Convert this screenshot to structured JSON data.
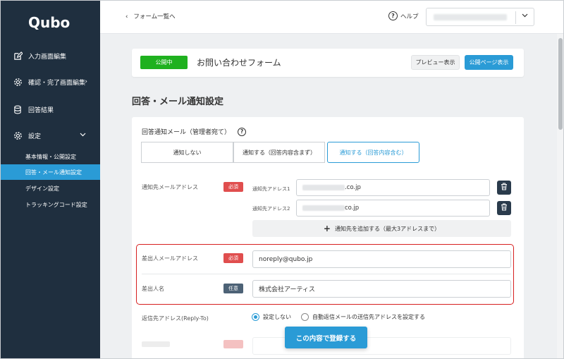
{
  "app": {
    "logo": "Qubo"
  },
  "sidebar": {
    "items": [
      {
        "label": "入力画面編集",
        "icon": "edit-icon"
      },
      {
        "label": "確認・完了画面編集",
        "icon": "gear-icon",
        "chevron": "›"
      },
      {
        "label": "回答結果",
        "icon": "database-icon"
      },
      {
        "label": "設定",
        "icon": "gear-icon",
        "chevron": "⌄"
      }
    ],
    "sub_items": [
      {
        "label": "基本情報・公開設定"
      },
      {
        "label": "回答・メール通知設定",
        "active": true
      },
      {
        "label": "デザイン設定"
      },
      {
        "label": "トラッキングコード設定"
      }
    ]
  },
  "topbar": {
    "back_label": "フォーム一覧へ",
    "help_label": "ヘルプ"
  },
  "form": {
    "status_badge": "公開中",
    "name": "お問い合わせフォーム",
    "preview_button": "プレビュー表示",
    "public_button": "公開ページ表示"
  },
  "page_title": "回答・メール通知設定",
  "notify": {
    "section_title": "回答通知メール（管理者宛て）",
    "options": [
      "通知しない",
      "通知する（回答内容含まず）",
      "通知する（回答内容含む）"
    ],
    "selected_index": 2
  },
  "recipients": {
    "label": "通知先メールアドレス",
    "badge": "必須",
    "addresses": [
      {
        "label": "通知先アドレス1",
        "value_suffix": ".co.jp"
      },
      {
        "label": "通知先アドレス2",
        "value_suffix": "co.jp"
      }
    ],
    "add_button": "通知先を追加する（最大3アドレスまで）"
  },
  "sender": {
    "email_label": "差出人メールアドレス",
    "email_badge": "必須",
    "email_value": "noreply@qubo.jp",
    "name_label": "差出人名",
    "name_badge": "任意",
    "name_value": "株式会社アーティス"
  },
  "reply_to": {
    "label": "返信先アドレス(Reply-To)",
    "options": [
      "設定しない",
      "自動返信メールの送信先アドレスを設定する"
    ],
    "selected_index": 0
  },
  "submit_button": "この内容で登録する",
  "colors": {
    "sidebar_bg": "#1f2f3f",
    "accent": "#2a9bd6",
    "published": "#1fb11f",
    "required": "#e04e4e",
    "optional": "#4d6276",
    "highlight": "#d71f1f"
  }
}
